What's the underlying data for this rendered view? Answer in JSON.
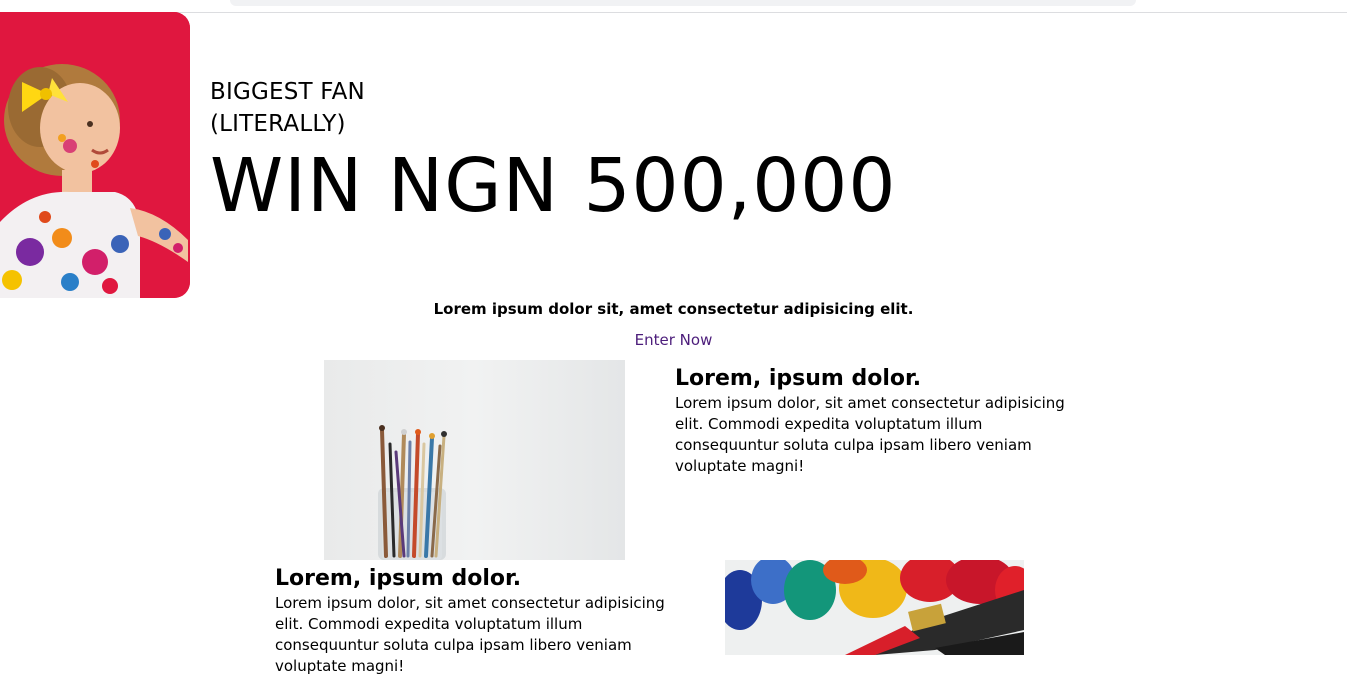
{
  "hero": {
    "tagline_line1": "BIGGEST FAN",
    "tagline_line2": "(LITERALLY)",
    "headline": "WIN NGN 500,000",
    "image_icon": "child-with-paint-photo"
  },
  "intro": {
    "text": "Lorem ipsum dolor sit, amet consectetur adipisicing elit.",
    "cta_label": "Enter Now"
  },
  "features": [
    {
      "title": "Lorem, ipsum dolor.",
      "body": "Lorem ipsum dolor, sit amet consectetur adipisicing elit. Commodi expedita voluptatum illum consequuntur soluta culpa ipsam libero veniam voluptate magni!",
      "image_icon": "paint-brushes-jar-photo"
    },
    {
      "title": "Lorem, ipsum dolor.",
      "body": "Lorem ipsum dolor, sit amet consectetur adipisicing elit. Commodi expedita voluptatum illum consequuntur soluta culpa ipsam libero veniam voluptate magni!",
      "image_icon": "paint-tubes-brush-photo"
    }
  ],
  "colors": {
    "hero_background": "#e0173f",
    "cta_text": "#4c1d7b",
    "text": "#000000"
  }
}
